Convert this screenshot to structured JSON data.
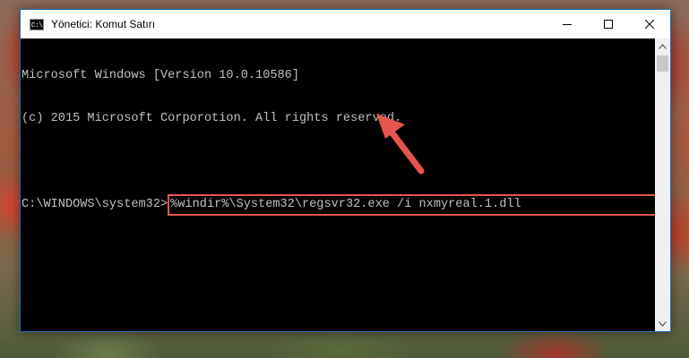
{
  "window": {
    "title": "Yönetici: Komut Satırı"
  },
  "console": {
    "lines": [
      "Microsoft Windows [Version 10.0.10586]",
      "(c) 2015 Microsoft Corporotion. All rights reserved.",
      ""
    ],
    "prompt": "C:\\WINDOWS\\system32>",
    "command": "%windir%\\System32\\regsvr32.exe /i nxmyreal.1.dll"
  },
  "colors": {
    "highlight": "#e6554c",
    "console_text": "#c0c0c0",
    "console_bg": "#000000"
  },
  "icons": {
    "app": "cmd-icon",
    "minimize": "minimize-icon",
    "maximize": "maximize-icon",
    "close": "close-icon",
    "annotation": "red-arrow-icon"
  }
}
